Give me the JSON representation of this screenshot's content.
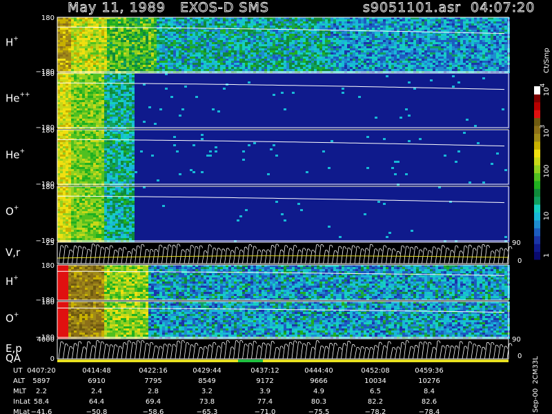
{
  "chart_data": {
    "type": "heatmap",
    "title_left": "May 11, 1989   EXOS-D SMS",
    "title_right": "s9051101.asr  04:07:20",
    "panels": [
      {
        "label": "H",
        "charge": "+",
        "ytop": "180",
        "ybot": "−180",
        "kind": "spectrogram",
        "style": "hplus"
      },
      {
        "label": "He",
        "charge": "++",
        "ytop": "180",
        "ybot": "−180",
        "kind": "spectrogram",
        "style": "quiet"
      },
      {
        "label": "He",
        "charge": "+",
        "ytop": "180",
        "ybot": "−180",
        "kind": "spectrogram",
        "style": "quiet"
      },
      {
        "label": "O",
        "charge": "+",
        "ytop": "180",
        "ybot": "−180",
        "kind": "spectrogram",
        "style": "quiet"
      },
      {
        "label": "V,r",
        "charge": "",
        "ytop": "25",
        "ybot": "",
        "right_top": "90",
        "right_bot": "0",
        "kind": "vector"
      },
      {
        "label": "H",
        "charge": "+",
        "ytop": "180",
        "ybot": "−180",
        "kind": "spectrogram",
        "style": "striped"
      },
      {
        "label": "O",
        "charge": "+",
        "ytop": "180",
        "ybot": "−180",
        "kind": "spectrogram",
        "style": "striped"
      },
      {
        "label": "E,p",
        "label2": "QA",
        "charge": "",
        "ytop": "4000",
        "ybot": "0",
        "right_top": "90",
        "right_bot": "0",
        "kind": "vector"
      }
    ],
    "colorbar": {
      "unit": "Ct/Smp",
      "ticks": [
        {
          "base": "1",
          "exp": ""
        },
        {
          "base": "10",
          "exp": ""
        },
        {
          "base": "100",
          "exp": ""
        },
        {
          "base": "10",
          "exp": "3"
        },
        {
          "base": "10",
          "exp": "4"
        }
      ],
      "colors": [
        "#0a0a6e",
        "#0f1a8c",
        "#1a35a8",
        "#1c5cc0",
        "#1e8cd0",
        "#18b8d8",
        "#16d0c0",
        "#10a060",
        "#0f8a3a",
        "#20b020",
        "#50c020",
        "#90d020",
        "#c8d818",
        "#f0e010",
        "#c8b000",
        "#a08a18",
        "#8c7018",
        "#6e5a10",
        "#e01010",
        "#b80000",
        "#800000",
        "#ffffff"
      ]
    },
    "time_axis": {
      "row_labels": [
        "UT",
        "ALT",
        "MLT",
        "InLat",
        "MLat"
      ],
      "columns": [
        {
          "UT": "0407:20",
          "ALT": "5897",
          "MLT": "2.2",
          "InLat": "58.4",
          "MLat": "−41.6"
        },
        {
          "UT": "0414:48",
          "ALT": "6910",
          "MLT": "2.4",
          "InLat": "64.4",
          "MLat": "−50.8"
        },
        {
          "UT": "0422:16",
          "ALT": "7795",
          "MLT": "2.8",
          "InLat": "69.4",
          "MLat": "−58.6"
        },
        {
          "UT": "0429:44",
          "ALT": "8549",
          "MLT": "3.2",
          "InLat": "73.8",
          "MLat": "−65.3"
        },
        {
          "UT": "0437:12",
          "ALT": "9172",
          "MLT": "3.9",
          "InLat": "77.4",
          "MLat": "−71.0"
        },
        {
          "UT": "0444:40",
          "ALT": "9666",
          "MLT": "4.9",
          "InLat": "80.3",
          "MLat": "−75.5"
        },
        {
          "UT": "0452:08",
          "ALT": "10034",
          "MLT": "6.5",
          "InLat": "82.2",
          "MLat": "−78.2"
        },
        {
          "UT": "0459:36",
          "ALT": "10276",
          "MLT": "8.4",
          "InLat": "82.6",
          "MLat": "−78.4"
        }
      ]
    },
    "footer_note": "Sep-00  2CM33L"
  }
}
